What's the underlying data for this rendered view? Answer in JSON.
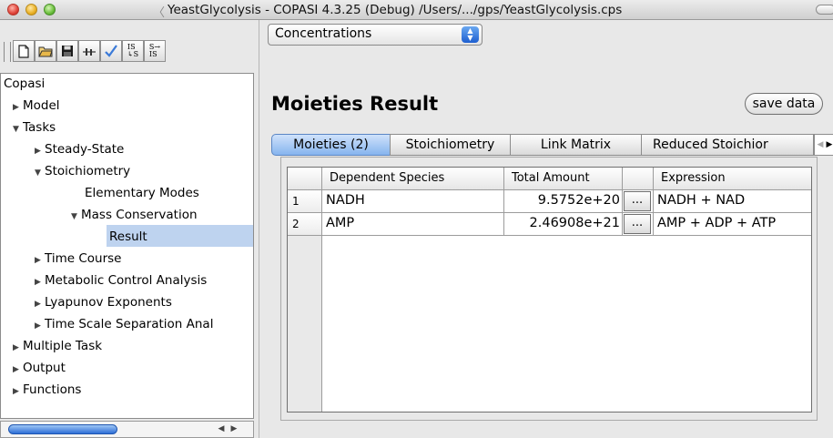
{
  "window": {
    "title": "YeastGlycolysis - COPASI 4.3.25 (Debug) /Users/.../gps/YeastGlycolysis.cps"
  },
  "toolbar": {
    "buttons": [
      {
        "name": "new-file",
        "icon": "document-icon"
      },
      {
        "name": "open-file",
        "icon": "folder-icon"
      },
      {
        "name": "save-file",
        "icon": "floppy-icon"
      },
      {
        "name": "slider",
        "icon": "slider-icon"
      },
      {
        "name": "check-model",
        "icon": "checkmark-icon"
      },
      {
        "name": "is-to-s",
        "icon": "is-s-icon",
        "top": "IS",
        "bottom": "S"
      },
      {
        "name": "s-to-is",
        "icon": "s-is-icon",
        "top": "S",
        "bottom": "IS"
      }
    ]
  },
  "tree": {
    "items": [
      {
        "label": "Copasi",
        "arrow": ""
      },
      {
        "label": "Model",
        "arrow": "▶"
      },
      {
        "label": "Tasks",
        "arrow": "▼"
      },
      {
        "label": "Steady-State",
        "arrow": "▶"
      },
      {
        "label": "Stoichiometry",
        "arrow": "▼"
      },
      {
        "label": "Elementary Modes",
        "arrow": ""
      },
      {
        "label": "Mass Conservation",
        "arrow": "▼"
      },
      {
        "label": "Result",
        "arrow": "",
        "selected": true
      },
      {
        "label": "Time Course",
        "arrow": "▶"
      },
      {
        "label": "Metabolic Control Analysis",
        "arrow": "▶"
      },
      {
        "label": "Lyapunov Exponents",
        "arrow": "▶"
      },
      {
        "label": "Time Scale Separation Anal",
        "arrow": "▶"
      },
      {
        "label": "Multiple Task",
        "arrow": "▶"
      },
      {
        "label": "Output",
        "arrow": "▶"
      },
      {
        "label": "Functions",
        "arrow": "▶"
      }
    ]
  },
  "main": {
    "view_select": "Concentrations",
    "title": "Moieties Result",
    "save_button": "save data",
    "tabs": [
      "Moieties (2)",
      "Stoichiometry",
      "Link Matrix",
      "Reduced Stoichior"
    ],
    "active_tab": 0,
    "table": {
      "columns": [
        "Dependent Species",
        "Total Amount",
        "",
        "Expression"
      ],
      "rows": [
        {
          "index": "1",
          "species": "NADH",
          "amount": "9.5752e+20",
          "button": "...",
          "expression": "NADH + NAD"
        },
        {
          "index": "2",
          "species": "AMP",
          "amount": "2.46908e+21",
          "button": "...",
          "expression": "AMP + ADP + ATP"
        }
      ]
    }
  },
  "colors": {
    "selection": "#bed3ef",
    "accent_blue": "#1e5fd0",
    "window_bg": "#e8e8e8"
  }
}
